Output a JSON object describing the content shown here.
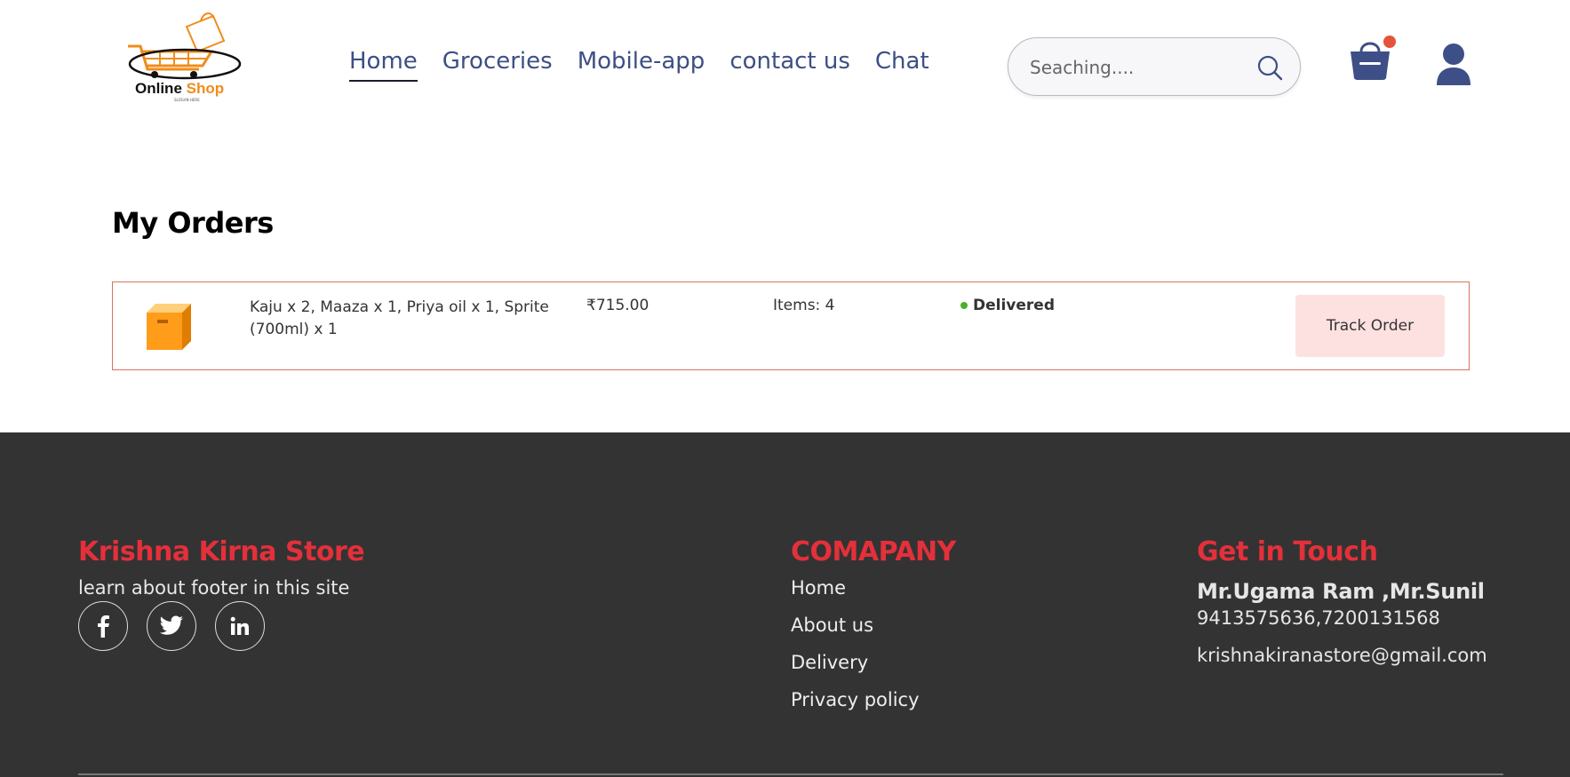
{
  "header": {
    "logo": {
      "brand_main": "Online",
      "brand_accent": "Shop",
      "tagline": "SLOGAN HERE"
    },
    "nav": [
      {
        "label": "Home",
        "active": true
      },
      {
        "label": "Groceries",
        "active": false
      },
      {
        "label": "Mobile-app",
        "active": false
      },
      {
        "label": "contact us",
        "active": false
      },
      {
        "label": "Chat",
        "active": false
      }
    ],
    "search": {
      "placeholder": "Seaching....",
      "icon": "search-icon"
    },
    "cart": {
      "icon": "basket-icon",
      "has_notification": true,
      "dot_color": "#e5533c"
    },
    "user": {
      "icon": "user-icon"
    }
  },
  "main": {
    "title": "My Orders",
    "orders": [
      {
        "icon": "box-icon",
        "items": "Kaju x 2, Maaza x 1, Priya oil x 1, Sprite (700ml) x 1",
        "price": "₹715.00",
        "count": "Items: 4",
        "status": "Delivered",
        "status_color": "#4caf2a",
        "action_label": "Track Order"
      }
    ]
  },
  "footer": {
    "brand": "Krishna Kirna Store",
    "description": "learn about footer in this site",
    "socials": [
      "facebook-icon",
      "twitter-icon",
      "linkedin-icon"
    ],
    "company_heading": "COMAPANY",
    "company_links": [
      "Home",
      "About us",
      "Delivery",
      "Privacy policy"
    ],
    "contact_heading": "Get in Touch",
    "contact_name": "Mr.Ugama Ram ,Mr.Sunil",
    "contact_phone": "9413575636,7200131568",
    "contact_email": "krishnakiranastore@gmail.com"
  },
  "colors": {
    "nav_text": "#3d4f86",
    "footer_bg": "#333333",
    "footer_heading": "#e3303a",
    "card_border": "#d9735c",
    "track_button_bg": "#fde1e1",
    "icon_navy": "#3d4f86"
  }
}
